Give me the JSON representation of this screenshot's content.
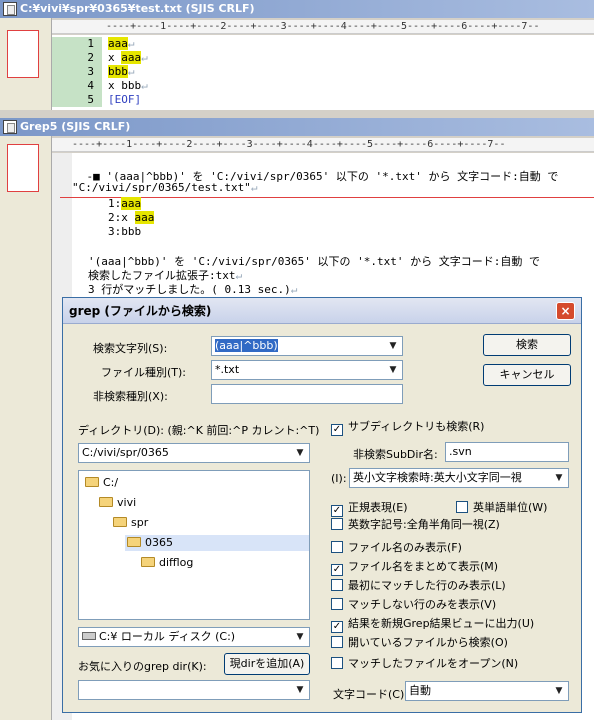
{
  "window1": {
    "title": "C:¥vivi¥spr¥0365¥test.txt (SJIS CRLF)",
    "ruler": "----+----1----+----2----+----3----+----4----+----5----+----6----+----7--",
    "lines": [
      {
        "num": "1",
        "text": "aaa",
        "hl": true,
        "pre": ""
      },
      {
        "num": "2",
        "text": "aaa",
        "hl": true,
        "pre": "x "
      },
      {
        "num": "3",
        "text": "bbb",
        "hl": true,
        "pre": ""
      },
      {
        "num": "4",
        "text": "x bbb",
        "hl": false,
        "pre": ""
      },
      {
        "num": "5",
        "text": "[EOF]",
        "hl": false,
        "pre": ""
      }
    ]
  },
  "window2": {
    "title": "Grep5 (SJIS CRLF)",
    "ruler": "----+----1----+----2----+----3----+----4----+----5----+----6----+----7--",
    "header": "'(aaa|^bbb)' を 'C:/vivi/spr/0365' 以下の '*.txt' から 文字コード:自動 で",
    "file": "\"C:/vivi/spr/0365/test.txt\"",
    "results": [
      "1:aaa",
      "2:x aaa",
      "3:bbb"
    ],
    "summary1": "'(aaa|^bbb)' を 'C:/vivi/spr/0365' 以下の '*.txt' から 文字コード:自動 で",
    "summary2": "検索したファイル拡張子:txt",
    "summary3": "3 行がマッチしました。( 0.13 sec.)"
  },
  "dialog": {
    "title": "grep (ファイルから検索)",
    "close": "×",
    "search_label": "検索文字列(S):",
    "search_value": "(aaa|^bbb)",
    "filetype_label": "ファイル種別(T):",
    "filetype_value": "*.txt",
    "exclude_label": "非検索種別(X):",
    "exclude_value": "",
    "search_button": "検索",
    "cancel_button": "キャンセル",
    "dir_label": "ディレクトリ(D): (親:^K 前回:^P カレント:^T)",
    "dir_value": "C:/vivi/spr/0365",
    "tree": [
      {
        "label": "C:/",
        "indent": 0,
        "sel": false
      },
      {
        "label": "vivi",
        "indent": 1,
        "sel": false
      },
      {
        "label": "spr",
        "indent": 2,
        "sel": false
      },
      {
        "label": "0365",
        "indent": 3,
        "sel": true
      },
      {
        "label": "difflog",
        "indent": 4,
        "sel": false
      }
    ],
    "drive_value": "C:¥ ローカル ディスク (C:)",
    "fav_label": "お気に入りのgrep dir(K):",
    "fav_add_button": "現dirを追加(A)",
    "fav_value": "",
    "subdir_check": "サブディレクトリも検索(R)",
    "exclude_subdir_label": "非検索SubDir名:",
    "exclude_subdir_value": ".svn",
    "case_label": "(I):",
    "case_value": "英小文字検索時:英大小文字同一視",
    "checks": [
      {
        "label": "正規表現(E)",
        "checked": true
      },
      {
        "label": "英単語単位(W)",
        "checked": false
      },
      {
        "label": "英数字記号:全角半角同一視(Z)",
        "checked": false
      },
      {
        "label": "ファイル名のみ表示(F)",
        "checked": false
      },
      {
        "label": "ファイル名をまとめて表示(M)",
        "checked": true
      },
      {
        "label": "最初にマッチした行のみ表示(L)",
        "checked": false
      },
      {
        "label": "マッチしない行のみを表示(V)",
        "checked": false
      },
      {
        "label": "結果を新規Grep結果ビューに出力(U)",
        "checked": true
      },
      {
        "label": "開いているファイルから検索(O)",
        "checked": false
      },
      {
        "label": "マッチしたファイルをオープン(N)",
        "checked": false
      }
    ],
    "encoding_label": "文字コード(C):",
    "encoding_value": "自動"
  }
}
